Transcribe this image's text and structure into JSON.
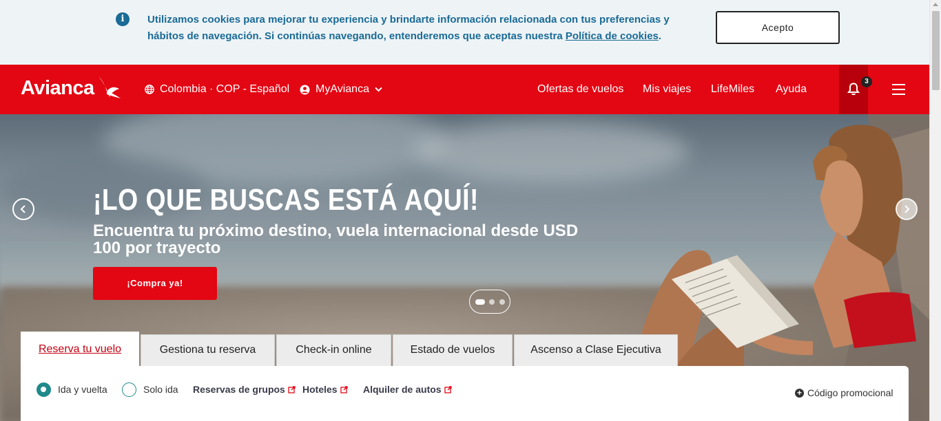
{
  "cookie": {
    "text_before": "Utilizamos cookies para mejorar tu experiencia y brindarte información relacionada con tus preferencias y hábitos de navegación. Si continúas navegando, entenderemos que aceptas nuestra ",
    "link": "Política de cookies",
    "text_after": ".",
    "accept_label": "Acepto",
    "info_icon": "i"
  },
  "header": {
    "logo": "Avianca",
    "region": "Colombia · COP - Español",
    "account": "MyAvianca",
    "nav": [
      "Ofertas de vuelos",
      "Mis viajes",
      "LifeMiles",
      "Ayuda"
    ],
    "notifications_count": "3"
  },
  "hero": {
    "title": "¡LO QUE BUSCAS ESTÁ AQUÍ!",
    "subtitle": "Encuentra tu próximo destino, vuela internacional desde USD 100 por trayecto",
    "cta": "¡Compra ya!"
  },
  "booking": {
    "tabs": [
      "Reserva tu vuelo",
      "Gestiona tu reserva",
      "Check-in online",
      "Estado de vuelos",
      "Ascenso a Clase Ejecutiva"
    ],
    "trip_types": [
      "Ida y vuelta",
      "Solo ida"
    ],
    "links": [
      "Reservas de grupos",
      "Hoteles",
      "Alquiler de autos"
    ],
    "promo": "Código promocional"
  },
  "colors": {
    "brand_red": "#e30613",
    "info_blue": "#1a6b96",
    "radio_teal": "#1f8a8a"
  },
  "icons": [
    "info-icon",
    "globe-icon",
    "user-icon",
    "chevron-down-icon",
    "bell-icon",
    "menu-icon",
    "chevron-left-icon",
    "chevron-right-icon",
    "external-link-icon",
    "plus-icon"
  ]
}
